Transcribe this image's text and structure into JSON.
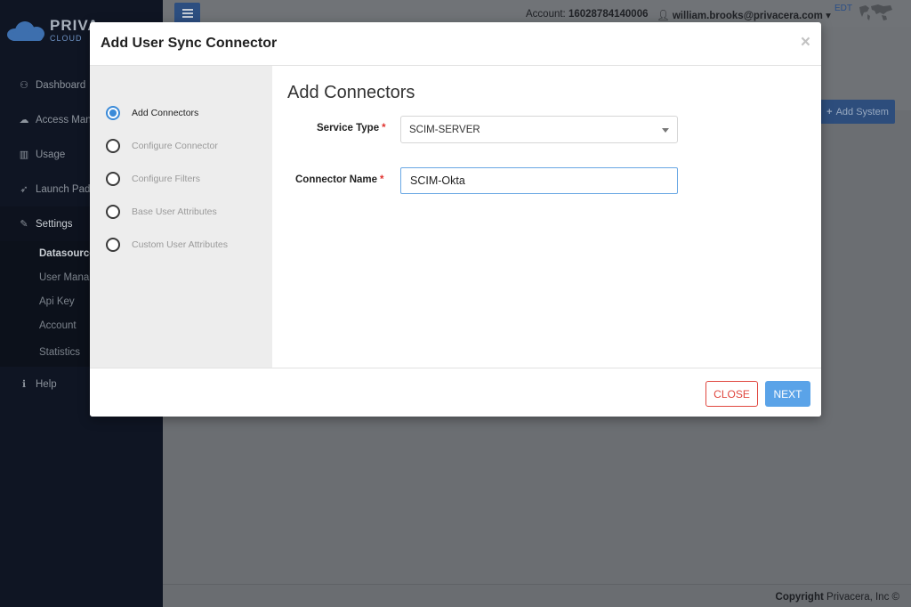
{
  "app": {
    "logo_text": "PRIVA",
    "logo_sub": "CLOUD",
    "account_label": "Account:",
    "account_id": "16028784140006",
    "user_email": "william.brooks@privacera.com",
    "timezone": "EDT",
    "add_system_label": "Add System",
    "footer_copyright_bold": "Copyright",
    "footer_copyright_rest": " Privacera, Inc ©"
  },
  "sidebar": {
    "items": [
      {
        "icon": "dashboard-icon",
        "label": "Dashboard"
      },
      {
        "icon": "cloud-icon",
        "label": "Access Mana"
      },
      {
        "icon": "bar-chart-icon",
        "label": "Usage"
      },
      {
        "icon": "rocket-icon",
        "label": "Launch Pad"
      },
      {
        "icon": "wrench-icon",
        "label": "Settings"
      }
    ],
    "settings_sub": [
      "Datasource",
      "User Mana",
      "Api Key",
      "Account",
      "Statistics"
    ],
    "help_label": "Help"
  },
  "modal": {
    "title": "Add User Sync Connector",
    "close_glyph": "×",
    "steps": [
      {
        "label": "Add Connectors",
        "current": true
      },
      {
        "label": "Configure Connector",
        "current": false
      },
      {
        "label": "Configure Filters",
        "current": false
      },
      {
        "label": "Base User Attributes",
        "current": false
      },
      {
        "label": "Custom User Attributes",
        "current": false
      }
    ],
    "content_title": "Add Connectors",
    "service_type_label": "Service Type",
    "service_type_value": "SCIM-SERVER",
    "connector_name_label": "Connector Name",
    "connector_name_value": "SCIM-Okta",
    "required_mark": "*",
    "close_button": "CLOSE",
    "next_button": "NEXT"
  },
  "colors": {
    "primary": "#5aa3e8",
    "danger": "#e0473f",
    "step_active": "#3a8ad8",
    "sidebar_bg": "#0f1523"
  }
}
